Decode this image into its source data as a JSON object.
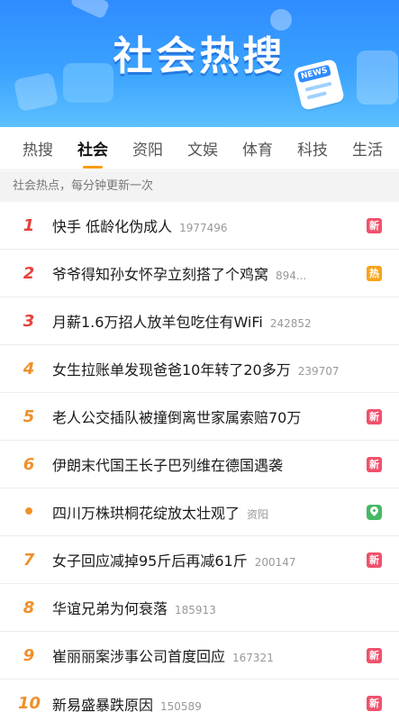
{
  "banner": {
    "title": "社会热搜",
    "news_label": "NEWS"
  },
  "tabs": [
    {
      "label": "热搜",
      "active": false
    },
    {
      "label": "社会",
      "active": true
    },
    {
      "label": "资阳",
      "active": false
    },
    {
      "label": "文娱",
      "active": false
    },
    {
      "label": "体育",
      "active": false
    },
    {
      "label": "科技",
      "active": false
    },
    {
      "label": "生活",
      "active": false
    }
  ],
  "notice": "社会热点，每分钟更新一次",
  "items": [
    {
      "rank": "1",
      "title": "快手 低龄化伪成人",
      "count": "1977496",
      "badge": "新",
      "badge_type": "new"
    },
    {
      "rank": "2",
      "title": "爷爷得知孙女怀孕立刻搭了个鸡窝",
      "count": "894...",
      "badge": "热",
      "badge_type": "hot"
    },
    {
      "rank": "3",
      "title": "月薪1.6万招人放羊包吃住有WiFi",
      "count": "242852",
      "badge": "",
      "badge_type": ""
    },
    {
      "rank": "4",
      "title": "女生拉账单发现爸爸10年转了20多万",
      "count": "239707",
      "badge": "",
      "badge_type": ""
    },
    {
      "rank": "5",
      "title": "老人公交插队被撞倒离世家属索赔70万",
      "count": "",
      "badge": "新",
      "badge_type": "new"
    },
    {
      "rank": "6",
      "title": "伊朗末代国王长子巴列维在德国遇袭",
      "count": "",
      "badge": "新",
      "badge_type": "new"
    },
    {
      "rank": "•",
      "title": "四川万株珙桐花绽放太壮观了",
      "count": "资阳",
      "badge": "",
      "badge_type": "loc"
    },
    {
      "rank": "7",
      "title": "女子回应减掉95斤后再减61斤",
      "count": "200147",
      "badge": "新",
      "badge_type": "new"
    },
    {
      "rank": "8",
      "title": "华谊兄弟为何衰落",
      "count": "185913",
      "badge": "",
      "badge_type": ""
    },
    {
      "rank": "9",
      "title": "崔丽丽案涉事公司首度回应",
      "count": "167321",
      "badge": "新",
      "badge_type": "new"
    },
    {
      "rank": "10",
      "title": "新易盛暴跌原因",
      "count": "150589",
      "badge": "新",
      "badge_type": "new"
    }
  ]
}
